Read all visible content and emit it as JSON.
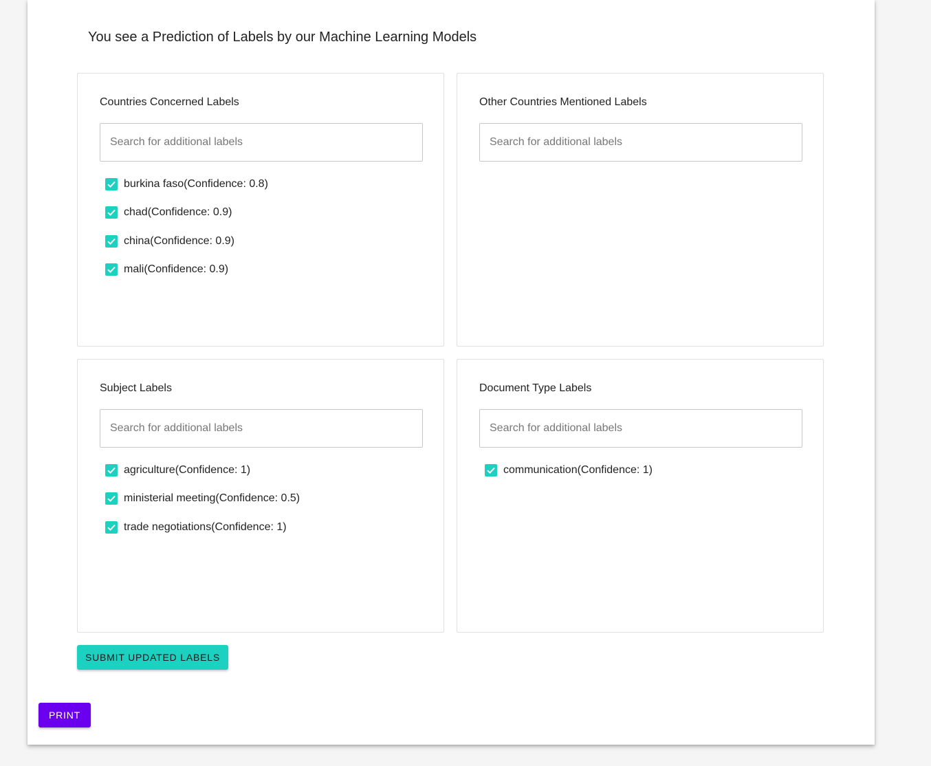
{
  "header": {
    "title": "You see a Prediction of Labels by our Machine Learning Models"
  },
  "colors": {
    "accent": "#1dd1c1",
    "print_button": "#6a00ee"
  },
  "panels": [
    {
      "title": "Countries Concerned Labels",
      "search_placeholder": "Search for additional labels",
      "search_value": "",
      "labels": [
        {
          "text": "burkina faso(Confidence: 0.8)",
          "checked": true
        },
        {
          "text": "chad(Confidence: 0.9)",
          "checked": true
        },
        {
          "text": "china(Confidence: 0.9)",
          "checked": true
        },
        {
          "text": "mali(Confidence: 0.9)",
          "checked": true
        }
      ]
    },
    {
      "title": "Other Countries Mentioned Labels",
      "search_placeholder": "Search for additional labels",
      "search_value": "",
      "labels": []
    },
    {
      "title": "Subject Labels",
      "search_placeholder": "Search for additional labels",
      "search_value": "",
      "labels": [
        {
          "text": "agriculture(Confidence: 1)",
          "checked": true
        },
        {
          "text": "ministerial meeting(Confidence: 0.5)",
          "checked": true
        },
        {
          "text": "trade negotiations(Confidence: 1)",
          "checked": true
        }
      ]
    },
    {
      "title": "Document Type Labels",
      "search_placeholder": "Search for additional labels",
      "search_value": "",
      "labels": [
        {
          "text": "communication(Confidence: 1)",
          "checked": true
        }
      ]
    }
  ],
  "actions": {
    "submit_label": "SUBMIT UPDATED LABELS",
    "print_label": "PRINT"
  }
}
